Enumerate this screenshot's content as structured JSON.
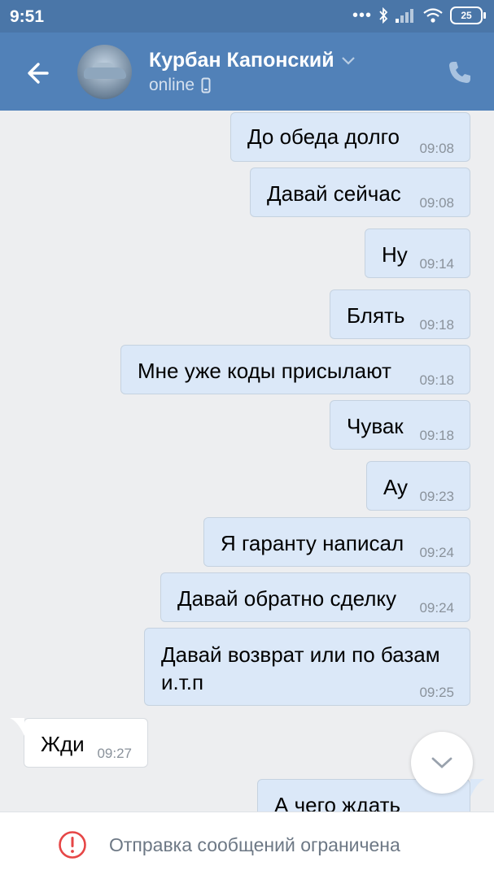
{
  "status_bar": {
    "time": "9:51",
    "battery": "25",
    "icons": [
      "dots-icon",
      "bluetooth-icon",
      "signal-icon",
      "wifi-icon",
      "battery-icon"
    ]
  },
  "header": {
    "contact_name": "Курбан Капонский",
    "contact_status": "online",
    "icons": [
      "back-arrow-icon",
      "chevron-down-icon",
      "mobile-icon",
      "phone-icon"
    ]
  },
  "messages": [
    {
      "text": "До обеда долго",
      "time": "09:08"
    },
    {
      "text": "Давай сейчас",
      "time": "09:08"
    },
    {
      "text": "Ну",
      "time": "09:14"
    },
    {
      "text": "Блять",
      "time": "09:18"
    },
    {
      "text": "Мне уже коды присылают",
      "time": "09:18"
    },
    {
      "text": "Чувак",
      "time": "09:18"
    },
    {
      "text": "Ау",
      "time": "09:23"
    },
    {
      "text": "Я гаранту написал",
      "time": "09:24"
    },
    {
      "text": "Давай обратно сделку",
      "time": "09:24"
    },
    {
      "text": "Давай возврат или по базам",
      "text2": "и.т.п",
      "time": "09:25"
    },
    {
      "text": "Жди",
      "time": "09:27"
    },
    {
      "text": "А чего ждать",
      "time": ""
    }
  ],
  "footer": {
    "notice": "Отправка сообщений ограничена"
  },
  "colors": {
    "header": "#5181b8",
    "outgoing_bubble": "#dbe8f8",
    "incoming_bubble": "#ffffff",
    "alert": "#e64646"
  }
}
